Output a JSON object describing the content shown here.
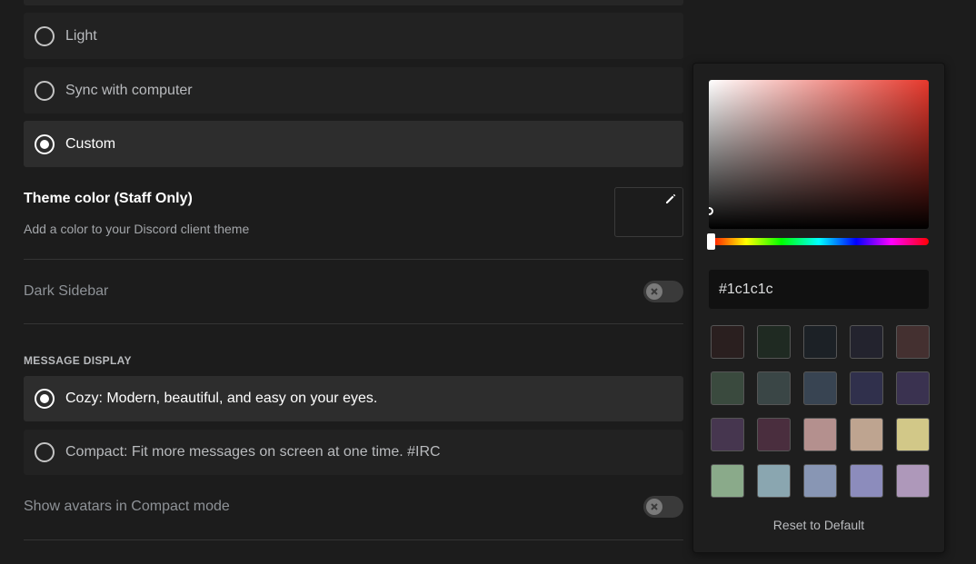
{
  "theme_options": [
    {
      "label": "Light",
      "selected": false
    },
    {
      "label": "Sync with computer",
      "selected": false
    },
    {
      "label": "Custom",
      "selected": true
    }
  ],
  "theme_color": {
    "title": "Theme color (Staff Only)",
    "description": "Add a color to your Discord client theme",
    "value": "#1c1c1c"
  },
  "dark_sidebar": {
    "label": "Dark Sidebar",
    "enabled": false
  },
  "message_display": {
    "header": "MESSAGE DISPLAY",
    "options": [
      {
        "label": "Cozy: Modern, beautiful, and easy on your eyes.",
        "selected": true
      },
      {
        "label": "Compact: Fit more messages on screen at one time. #IRC",
        "selected": false
      }
    ]
  },
  "show_avatars": {
    "label": "Show avatars in Compact mode",
    "enabled": false
  },
  "color_picker": {
    "hex_value": "#1c1c1c",
    "swatches": [
      "#2a1f1f",
      "#1f2a22",
      "#1c2126",
      "#23232e",
      "#443030",
      "#3a4a3e",
      "#3a4646",
      "#384452",
      "#30304c",
      "#3a3250",
      "#46364f",
      "#4a2e3e",
      "#b4908e",
      "#bea490",
      "#d2c888",
      "#8aaa8a",
      "#8aa6b0",
      "#8896b4",
      "#8c8cbc",
      "#ae98ba"
    ],
    "reset_label": "Reset to Default"
  }
}
